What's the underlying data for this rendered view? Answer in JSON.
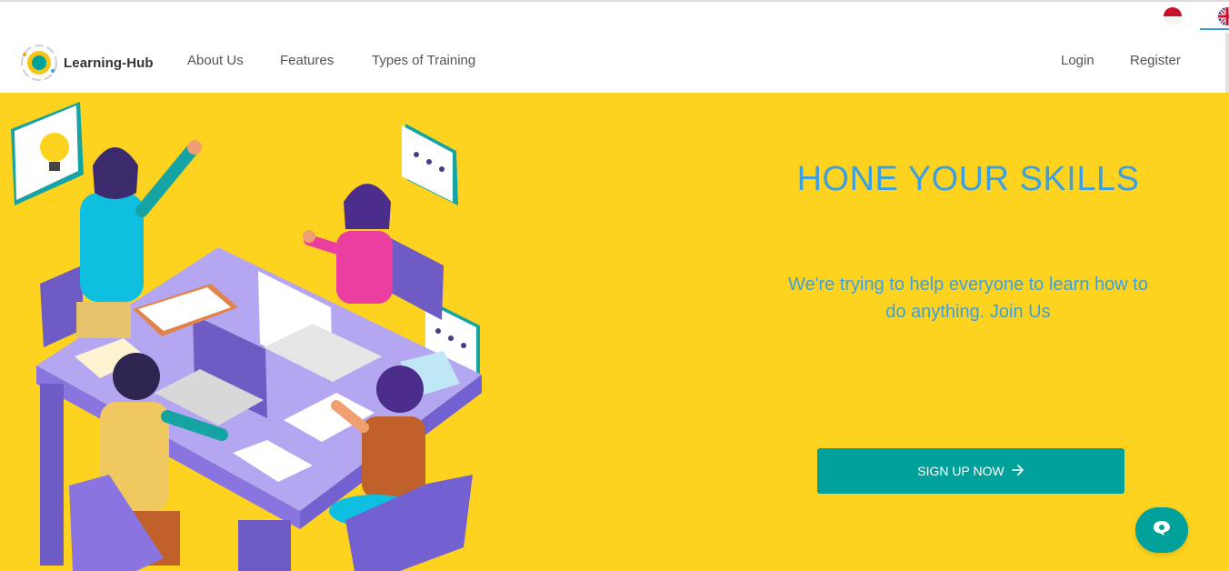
{
  "header": {
    "brand_name": "Learning-Hub",
    "nav_left": [
      "About Us",
      "Features",
      "Types of Training"
    ],
    "nav_right": [
      "Login",
      "Register"
    ],
    "languages": [
      "indonesia-flag-icon",
      "uk-flag-icon"
    ],
    "active_language": "uk-flag-icon"
  },
  "hero": {
    "title": "HONE YOUR SKILLS",
    "subtitle": "We're trying to help everyone to learn how to do anything. Join Us",
    "cta_label": "SIGN UP NOW",
    "cta_icon": "arrow-right-icon",
    "background_color": "#fdd31f",
    "accent_color": "#00a19a",
    "text_color": "#3c9fe0"
  },
  "chat": {
    "icon": "chat-bubble-icon"
  }
}
